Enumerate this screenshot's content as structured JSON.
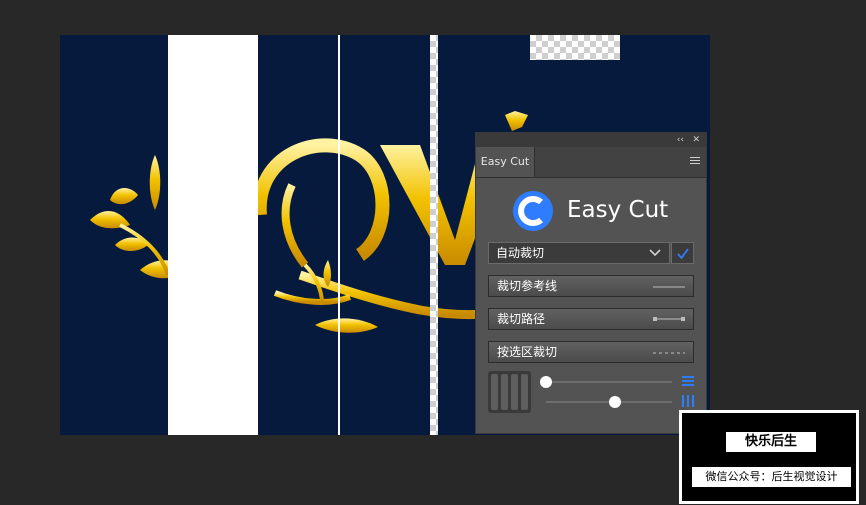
{
  "panel": {
    "tab_label": "Easy Cut",
    "collapse_glyph": "‹‹",
    "close_glyph": "✕",
    "logo_text": "Easy Cut",
    "dropdown_value": "自动裁切",
    "buttons": [
      {
        "label": "裁切参考线"
      },
      {
        "label": "裁切路径"
      },
      {
        "label": "按选区裁切"
      }
    ],
    "sliders": [
      {
        "value": 0.0
      },
      {
        "value": 0.55
      }
    ],
    "icons": [
      "collapse-icon",
      "close-icon",
      "panel-menu-icon",
      "chevron-down-icon",
      "checkmark-icon",
      "horizontal-lines-icon",
      "vertical-lines-icon"
    ],
    "accent_color": "#2f7dff"
  },
  "watermark": {
    "title": "快乐后生",
    "subtitle": "微信公众号：后生视觉设计"
  },
  "colors": {
    "app_background": "#282828",
    "canvas_background": "#061a3d",
    "panel_background": "#535353",
    "gold": "#f2c200"
  }
}
